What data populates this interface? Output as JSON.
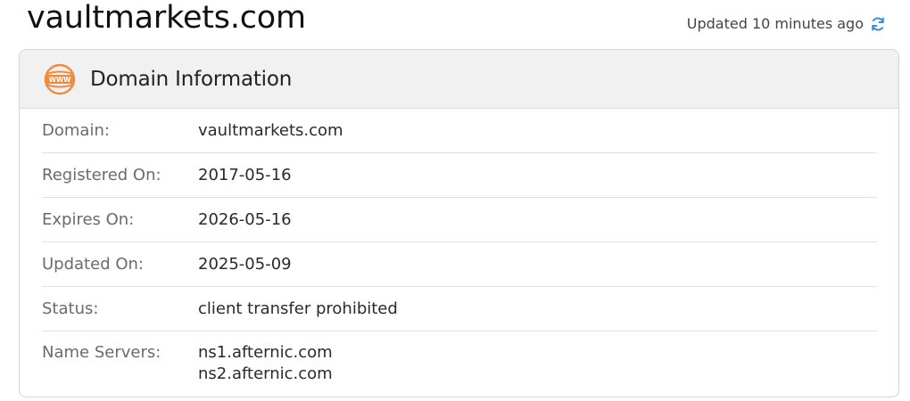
{
  "domain_title": "vaultmarkets.com",
  "updated_text": "Updated 10 minutes ago",
  "card": {
    "title": "Domain Information",
    "icon": "www-icon",
    "rows": [
      {
        "label": "Domain:",
        "value": "vaultmarkets.com"
      },
      {
        "label": "Registered On:",
        "value": "2017-05-16"
      },
      {
        "label": "Expires On:",
        "value": "2026-05-16"
      },
      {
        "label": "Updated On:",
        "value": "2025-05-09"
      },
      {
        "label": "Status:",
        "value": "client transfer prohibited"
      }
    ],
    "name_servers": {
      "label": "Name Servers:",
      "values": [
        "ns1.afternic.com",
        "ns2.afternic.com"
      ]
    }
  },
  "colors": {
    "accent_orange": "#f08a3c",
    "refresh_blue": "#3a8fd6",
    "header_bg": "#f1f1f1"
  }
}
